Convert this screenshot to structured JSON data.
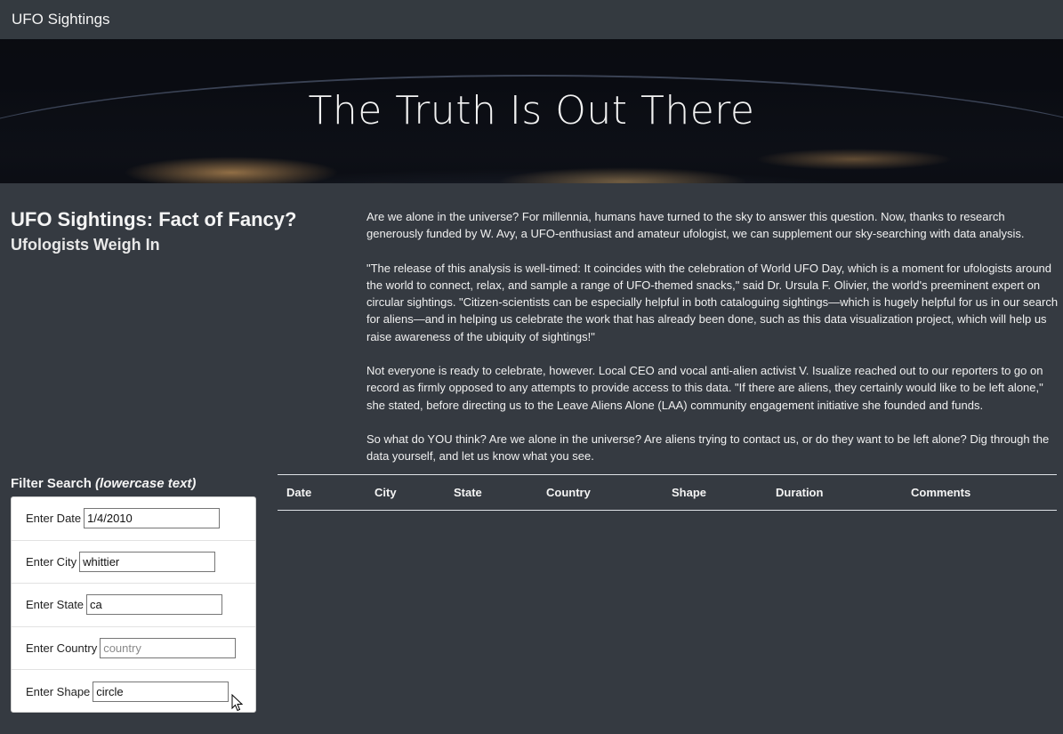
{
  "navbar": {
    "brand": "UFO Sightings"
  },
  "hero": {
    "heading": "The Truth Is Out There"
  },
  "article": {
    "title": "UFO Sightings: Fact of Fancy?",
    "subtitle": "Ufologists Weigh In",
    "paragraphs": [
      "Are we alone in the universe? For millennia, humans have turned to the sky to answer this question. Now, thanks to research generously funded by W. Avy, a UFO-enthusiast and amateur ufologist, we can supplement our sky-searching with data analysis.",
      "\"The release of this analysis is well-timed: It coincides with the celebration of World UFO Day, which is a moment for ufologists around the world to connect, relax, and sample a range of UFO-themed snacks,\" said Dr. Ursula F. Olivier, the world's preeminent expert on circular sightings. \"Citizen-scientists can be especially helpful in both cataloguing sightings—which is hugely helpful for us in our search for aliens—and in helping us celebrate the work that has already been done, such as this data visualization project, which will help us raise awareness of the ubiquity of sightings!\"",
      "Not everyone is ready to celebrate, however. Local CEO and vocal anti-alien activist V. Isualize reached out to our reporters to go on record as firmly opposed to any attempts to provide access to this data. \"If there are aliens, they certainly would like to be left alone,\" she stated, before directing us to the Leave Aliens Alone (LAA) community engagement initiative she founded and funds.",
      "So what do YOU think? Are we alone in the universe? Are aliens trying to contact us, or do they want to be left alone? Dig through the data yourself, and let us know what you see."
    ]
  },
  "filters": {
    "title": "Filter Search",
    "title_note": "(lowercase text)",
    "fields": [
      {
        "label": "Enter Date",
        "value": "1/4/2010",
        "placeholder": ""
      },
      {
        "label": "Enter City",
        "value": "whittier",
        "placeholder": ""
      },
      {
        "label": "Enter State",
        "value": "ca",
        "placeholder": ""
      },
      {
        "label": "Enter Country",
        "value": "",
        "placeholder": "country"
      },
      {
        "label": "Enter Shape",
        "value": "circle",
        "placeholder": ""
      }
    ]
  },
  "table": {
    "columns": [
      "Date",
      "City",
      "State",
      "Country",
      "Shape",
      "Duration",
      "Comments"
    ],
    "rows": []
  }
}
